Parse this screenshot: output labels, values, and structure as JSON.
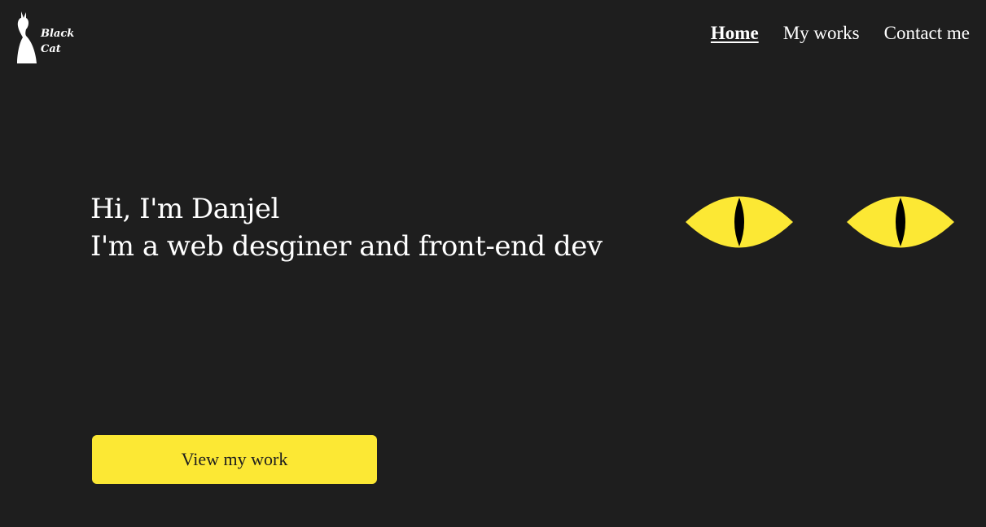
{
  "brand": {
    "logo_icon": "cat-silhouette-icon",
    "line1": "Black",
    "line2": "Cat"
  },
  "nav": {
    "items": [
      {
        "label": "Home",
        "active": true
      },
      {
        "label": "My works",
        "active": false
      },
      {
        "label": "Contact me",
        "active": false
      }
    ]
  },
  "hero": {
    "line1": "Hi, I'm Danjel",
    "line2": "I'm a web desginer and front-end dev"
  },
  "eyes": {
    "icon": "cat-eyes-icon",
    "iris_color": "#fce834",
    "pupil_color": "#000000"
  },
  "cta": {
    "label": "View my work"
  },
  "colors": {
    "background": "#1e1e1e",
    "accent": "#fce834",
    "text": "#ffffff"
  }
}
